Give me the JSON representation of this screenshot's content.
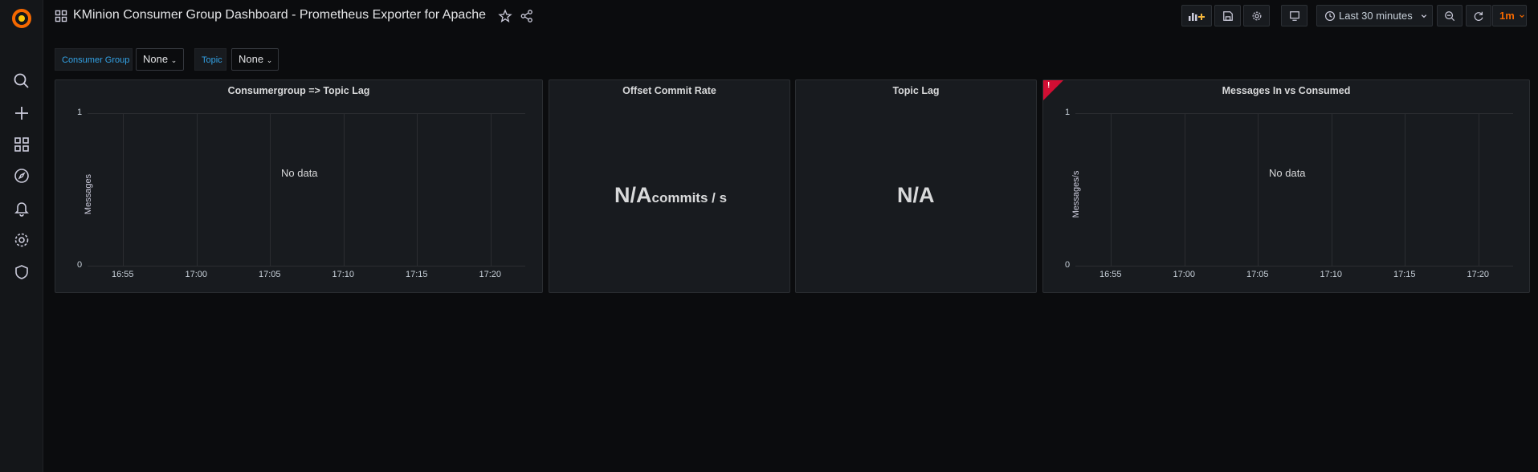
{
  "dashboard": {
    "title": "KMinion Consumer Group Dashboard - Prometheus Exporter for Apache"
  },
  "toolbar": {
    "time_range": "Last 30 minutes",
    "refresh_interval": "1m"
  },
  "variables": [
    {
      "label": "Consumer Group",
      "value": "None"
    },
    {
      "label": "Topic",
      "value": "None"
    }
  ],
  "panels": {
    "consumergroup_lag": {
      "title": "Consumergroup => Topic Lag",
      "ylabel": "Messages",
      "no_data": "No data"
    },
    "offset_commit_rate": {
      "title": "Offset Commit Rate",
      "value": "N/A",
      "unit": "commits / s"
    },
    "topic_lag": {
      "title": "Topic Lag",
      "value": "N/A"
    },
    "messages_in_vs_consumed": {
      "title": "Messages In vs Consumed",
      "ylabel": "Messages/s",
      "no_data": "No data",
      "alert_state": "alerting"
    }
  },
  "chart_data": [
    {
      "type": "line",
      "title": "Consumergroup => Topic Lag",
      "ylabel": "Messages",
      "x": [
        "16:55",
        "17:00",
        "17:05",
        "17:10",
        "17:15",
        "17:20"
      ],
      "ylim": [
        0,
        1
      ],
      "yticks": [
        "1",
        "0"
      ],
      "series": [],
      "grid": true
    },
    {
      "type": "line",
      "title": "Messages In vs Consumed",
      "ylabel": "Messages/s",
      "x": [
        "16:55",
        "17:00",
        "17:05",
        "17:10",
        "17:15",
        "17:20"
      ],
      "ylim": [
        0,
        1
      ],
      "yticks": [
        "1",
        "0"
      ],
      "series": [],
      "grid": true
    }
  ],
  "colors": {
    "background": "#0b0c0e",
    "panel": "#181b1f",
    "accent_blue": "#33a2e5",
    "refresh_orange": "#f46800",
    "alert_red": "#d10e33"
  },
  "icons": {
    "sidebar": [
      "grafana-logo",
      "search-icon",
      "plus-icon",
      "dashboards-icon",
      "explore-icon",
      "bell-icon",
      "gear-icon",
      "shield-icon"
    ],
    "toolbar": [
      "add-panel-icon",
      "save-icon",
      "gear-icon",
      "tv-icon",
      "clock-icon",
      "chevron-down-icon",
      "zoom-out-icon",
      "refresh-icon"
    ]
  }
}
